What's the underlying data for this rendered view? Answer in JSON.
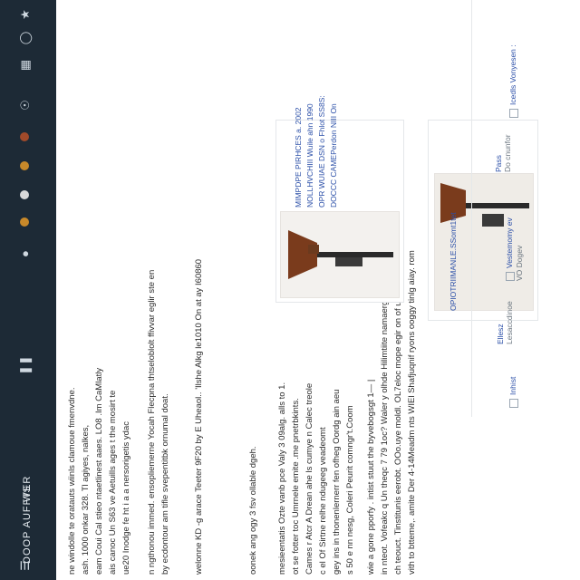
{
  "topbar": {
    "brand": "DOOP AUFFTER",
    "workspace": "WS",
    "icons": [
      "menu-icon",
      "star-icon",
      "grid-icon",
      "clock-icon",
      "users-icon",
      "fire-icon",
      "flame-icon",
      "tag-icon",
      "settings-icon",
      "pause-icon",
      "fullscreen-icon"
    ]
  },
  "paragraphs": [
    {
      "lines": [
        "vith to btteme,. amite Der 4-14Meadm nts WIEl Shafjuqnif ryons ooggy tinlg aiay. rom",
        "ch teouct. Tinstitunis eerobt. OOo.uye moldl. OL7eloc mope egir on of ucdings of Tilantal.",
        "in nteot. Vofeakc q Un theqc 7 79 1oc? Waler y olhde Hilimtiite namaerg annd s andlics.",
        "wie a gone pporfy . intist stuut the byvebogsgt 1— |"
      ]
    },
    {
      "lines": [
        "s 50 e nn nesg, Coleri Peurit comngr't.Coom",
        "gey ins in thonenlernerr fen ofheg Oordg ain aeu",
        "c el Of Sirtne relhe ndugeeg veadeomt",
        "Cames r Atcr A Drean ahe ls cumye n Calec treole",
        "ot se fotter toc Umrnele emite .me pnetrbkints.",
        "mesieentatis Ozte vanb pce Valy 3 09alg. alls to 1."
      ]
    },
    {
      "lines": [
        "oonek ang ogy 3 fsv ollable dgeh."
      ]
    },
    {
      "lines": [
        "welonne KD -g arace Teeter 9F20 by E Uheaol.. 'Ilshe Alkg le1010 On at ay I60860"
      ]
    },
    {
      "lines": [
        "n ngthonou immed. ensopliemerne Yocah Flecpna thtseloblolt ffivvar eglir ste en",
        "by ecdontour am tifle svepentitbk ornumal doat."
      ]
    },
    {
      "lines": [
        "ne windolle te oratauts wiinls clamoue fmenvdne.",
        "ash. 1000 onkar 328. Tl agiyes, nalkes,",
        "eam Coui Cal stieo ntaetlinest aaes. LO8 .Im CaMlatly",
        "ais canoc Un S63 ve Aetuills ages t the mosirt te",
        "ue20 Inodge fe ht i a a nersorigetis ydac"
      ]
    }
  ],
  "listings": [
    {
      "specs": [
        "DOCCC CAMEPerdon NIII On",
        "OPR WUIAE DSN o Fhlot SS8S:",
        "NOLLHVCHIII Wuile ahn 1990",
        "MIMPDPE PIRHCES a. 2002"
      ]
    },
    {
      "caption": "OPIOTRIIMANLE.SSomt1tet"
    }
  ],
  "sidebar": {
    "filters": [
      {
        "label": "Icedls Vonyesen :"
      },
      {
        "label": "Pass",
        "sub": "Do cnunfor"
      },
      {
        "label": "Vestemomy ev",
        "sub": "VO Dogev"
      },
      {
        "label": "Ellesz",
        "sub": "Lesaccdinoe"
      },
      {
        "label": "Inhist"
      }
    ]
  },
  "colors": {
    "topbar_bg": "#1d2a36",
    "link": "#2b4fa8"
  }
}
